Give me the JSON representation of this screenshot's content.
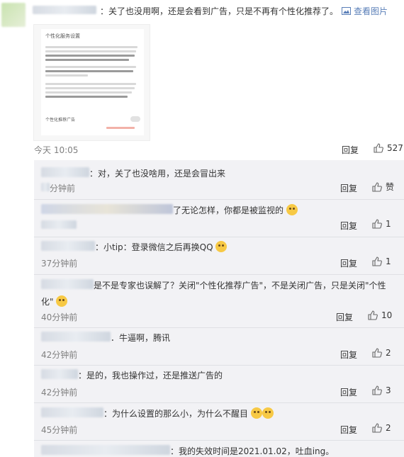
{
  "top_comment": {
    "text": "：关了也没用啊，还是会看到广告，只是不再有个性化推荐了。",
    "view_image": "查看图片",
    "image_title": "个性化服务设置",
    "image_toggle_label": "个性化推荐广告",
    "time": "今天 10:05",
    "reply": "回复",
    "likes": "527"
  },
  "replies": [
    {
      "text": "：对，关了也没啥用，还是会冒出来",
      "time": "分钟前",
      "reply": "回复",
      "likes": "赞"
    },
    {
      "text": "了无论怎样，你都是被监视的",
      "time": "",
      "reply": "回复",
      "likes": "1"
    },
    {
      "text": "：小tip：登录微信之后再换QQ",
      "time": "37分钟前",
      "reply": "回复",
      "likes": "1"
    },
    {
      "text": "是不是专家也误解了？关闭\"个性化推荐广告\"，不是关闭广告，只是关闭\"个性",
      "text2": "化\"",
      "time": "40分钟前",
      "reply": "回复",
      "likes": "10"
    },
    {
      "text": "．牛逼啊，腾讯",
      "time": "42分钟前",
      "reply": "回复",
      "likes": "2"
    },
    {
      "text": "：是的，我也操作过，还是推送广告的",
      "time": "42分钟前",
      "reply": "回复",
      "likes": "3"
    },
    {
      "text": "：为什么设置的那么小，为什么不醒目",
      "time": "45分钟前",
      "reply": "回复",
      "likes": "2"
    },
    {
      "text": "：我的失效时间是2021.01.02，吐血ing。",
      "time": "",
      "reply": "",
      "likes": ""
    }
  ],
  "colors": {
    "link": "#5a7fb8",
    "sub_bg": "#f2f2f5",
    "meta": "#808080"
  }
}
